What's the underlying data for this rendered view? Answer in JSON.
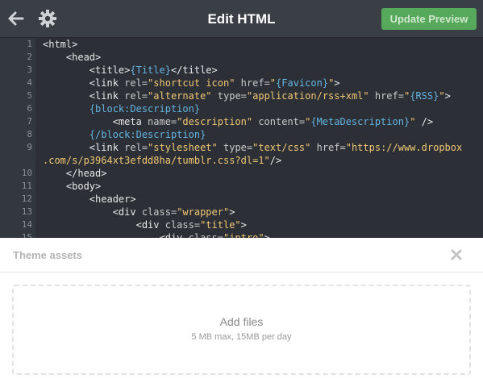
{
  "header": {
    "title": "Edit HTML",
    "update_label": "Update Preview",
    "back_icon": "arrow-left-icon",
    "settings_icon": "gear-icon"
  },
  "editor": {
    "line_numbers": [
      "1",
      "2",
      "3",
      "4",
      "5",
      "6",
      "7",
      "8",
      "9",
      "",
      "10",
      "11",
      "12",
      "13",
      "14",
      "15"
    ]
  },
  "assets": {
    "title": "Theme assets",
    "close_icon": "close-icon",
    "add_label": "Add files",
    "limit_label": "5 MB max, 15MB per day"
  },
  "colors": {
    "update_button": "#56a85a",
    "editor_bg": "#2c3036",
    "template_var": "#63b3e0",
    "string": "#f0c674"
  }
}
